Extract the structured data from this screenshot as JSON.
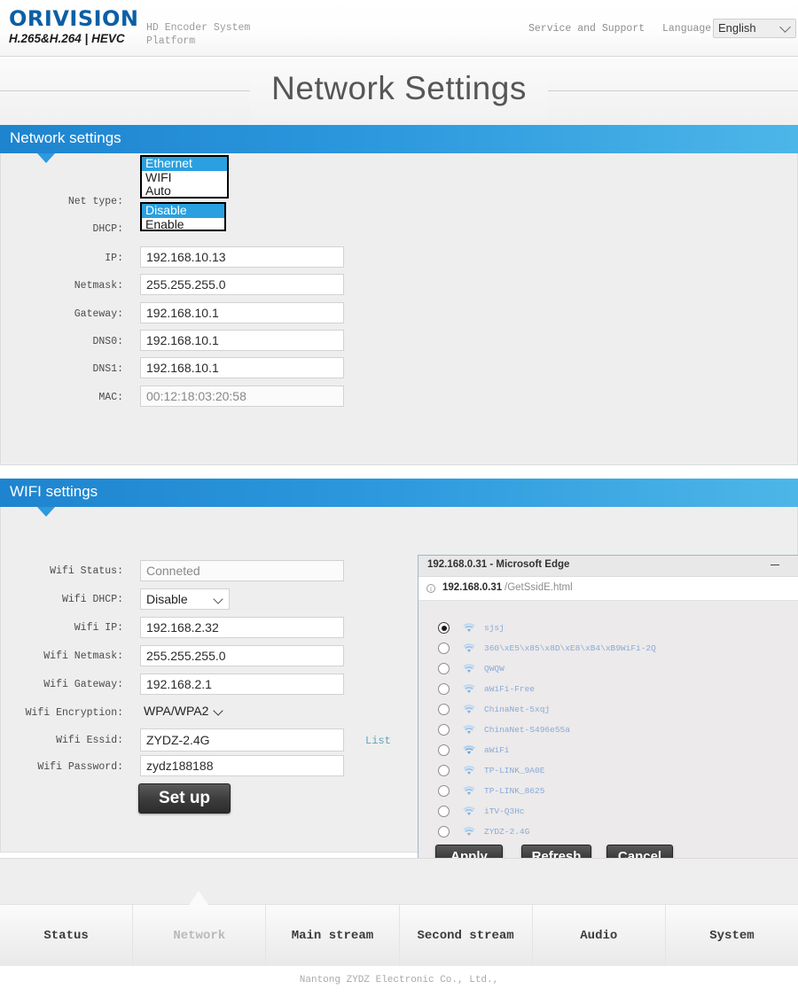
{
  "header": {
    "brand": "ORIVISION",
    "brand_sub": "H.265&H.264 | HEVC",
    "platform": "HD Encoder System Platform",
    "service_link": "Service and Support",
    "language_label": "Language:",
    "language_value": "English",
    "accent": "#0b5fa5"
  },
  "page_title": "Network Settings",
  "network_section": {
    "heading": "Network settings",
    "net_type": {
      "label": "Net type:",
      "options": [
        "Ethernet",
        "WIFI",
        "Auto"
      ],
      "selected": "Ethernet"
    },
    "dhcp": {
      "label": "DHCP:",
      "options": [
        "Disable",
        "Enable"
      ],
      "selected": "Disable"
    },
    "fields": [
      {
        "label": "IP:",
        "value": "192.168.10.13"
      },
      {
        "label": "Netmask:",
        "value": "255.255.255.0"
      },
      {
        "label": "Gateway:",
        "value": "192.168.10.1"
      },
      {
        "label": "DNS0:",
        "value": "192.168.10.1"
      },
      {
        "label": "DNS1:",
        "value": "192.168.10.1"
      },
      {
        "label": "MAC:",
        "value": "00:12:18:03:20:58"
      }
    ]
  },
  "wifi_section": {
    "heading": "WIFI settings",
    "status": {
      "label": "Wifi Status:",
      "value": "Conneted"
    },
    "dhcp": {
      "label": "Wifi DHCP:",
      "value": "Disable"
    },
    "ip": {
      "label": "Wifi IP:",
      "value": "192.168.2.32"
    },
    "netmask": {
      "label": "Wifi Netmask:",
      "value": "255.255.255.0"
    },
    "gateway": {
      "label": "Wifi Gateway:",
      "value": "192.168.2.1"
    },
    "encryption": {
      "label": "Wifi Encryption:",
      "value": "WPA/WPA2"
    },
    "essid": {
      "label": "Wifi Essid:",
      "value": "ZYDZ-2.4G"
    },
    "password": {
      "label": "Wifi Password:",
      "value": "zydz188188"
    },
    "list_link": "List",
    "setup_button": "Set up"
  },
  "edge_popup": {
    "window_title": "192.168.0.31 - Microsoft Edge",
    "url_host": "192.168.0.31",
    "url_path": "/GetSsidE.html",
    "minimize_icon": "minimize-icon",
    "maximize_icon": "maximize-icon",
    "ssids": [
      {
        "name": "sjsj",
        "selected": true
      },
      {
        "name": "360\\xE5\\x85\\x8D\\xE8\\xB4\\xB9WiFi-2Q",
        "selected": false
      },
      {
        "name": "QWQW",
        "selected": false
      },
      {
        "name": "aWiFi-Free",
        "selected": false
      },
      {
        "name": "ChinaNet-5xqj",
        "selected": false
      },
      {
        "name": "ChinaNet-S496e55a",
        "selected": false
      },
      {
        "name": "aWiFi",
        "selected": false
      },
      {
        "name": "TP-LINK_9A0E",
        "selected": false
      },
      {
        "name": "TP-LINK_8625",
        "selected": false
      },
      {
        "name": "iTV-Q3Hc",
        "selected": false
      },
      {
        "name": "ZYDZ-2.4G",
        "selected": false
      }
    ],
    "buttons": {
      "apply": "Apply",
      "refresh": "Refresh",
      "cancel": "Cancel"
    }
  },
  "nav": {
    "items": [
      {
        "label": "Status",
        "active": false
      },
      {
        "label": "Network",
        "active": true
      },
      {
        "label": "Main stream",
        "active": false
      },
      {
        "label": "Second stream",
        "active": false
      },
      {
        "label": "Audio",
        "active": false
      },
      {
        "label": "System",
        "active": false
      }
    ]
  },
  "copyright": "Nantong ZYDZ Electronic Co., Ltd.,"
}
